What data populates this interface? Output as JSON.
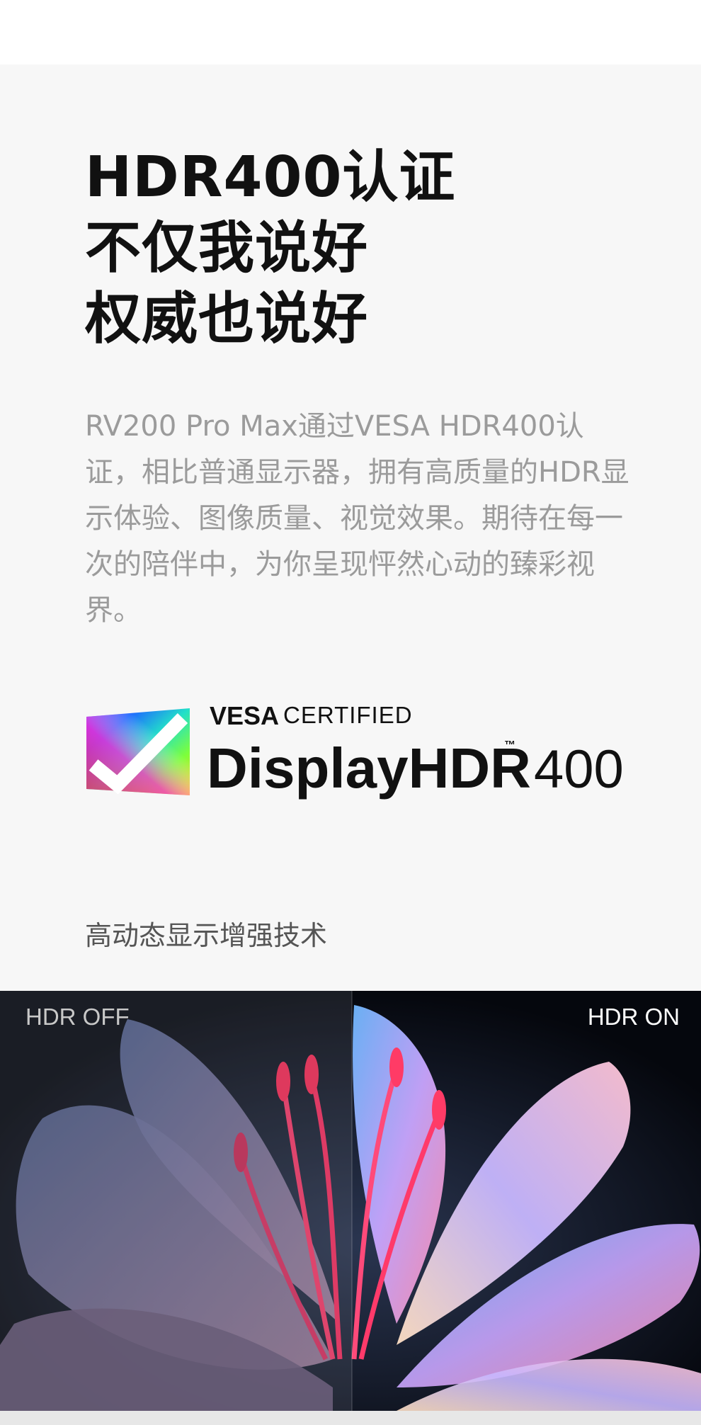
{
  "headline": {
    "line1": "HDR400认证",
    "line2": "不仅我说好",
    "line3": "权威也说好"
  },
  "description": "RV200 Pro Max通过VESA HDR400认证，相比普通显示器，拥有高质量的HDR显示体验、图像质量、视觉效果。期待在每一次的陪伴中，为你呈现怦然心动的臻彩视界。",
  "badge": {
    "brand": "VESA",
    "certified": "CERTIFIED",
    "product": "DisplayHDR",
    "trademark": "™",
    "level": "400"
  },
  "subcaption": "高动态显示增强技术",
  "comparison": {
    "left_label": "HDR OFF",
    "right_label": "HDR ON"
  },
  "colors": {
    "headline": "#111111",
    "description": "#9b9b9b",
    "section_background": "#f7f7f7",
    "photo_background": "#05070d"
  }
}
